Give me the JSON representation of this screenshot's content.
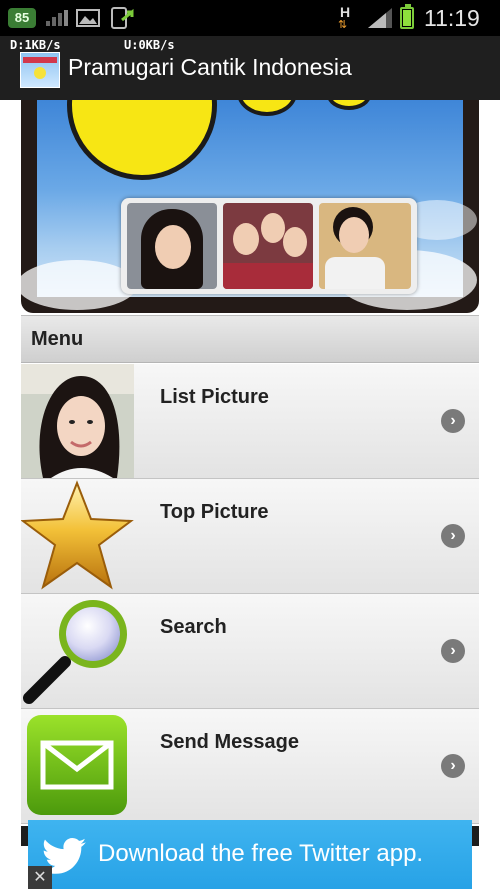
{
  "status_bar": {
    "badge": "85",
    "network_type": "H",
    "network_arrows": "⇅",
    "time": "11:19"
  },
  "title_bar": {
    "download_speed": "D:1KB/s",
    "upload_speed": "U:0KB/s",
    "title": "Pramugari Cantik Indonesia"
  },
  "menu": {
    "header": "Menu",
    "items": [
      {
        "label": "List Picture",
        "icon": "girl-photo-icon",
        "arrow": "›"
      },
      {
        "label": "Top Picture",
        "icon": "star-icon",
        "arrow": "›"
      },
      {
        "label": "Search",
        "icon": "magnifier-icon",
        "arrow": "›"
      },
      {
        "label": "Send Message",
        "icon": "envelope-icon",
        "arrow": "›"
      }
    ]
  },
  "ad": {
    "text": "Download the free Twitter app.",
    "close": "✕",
    "color": "#34acec"
  }
}
